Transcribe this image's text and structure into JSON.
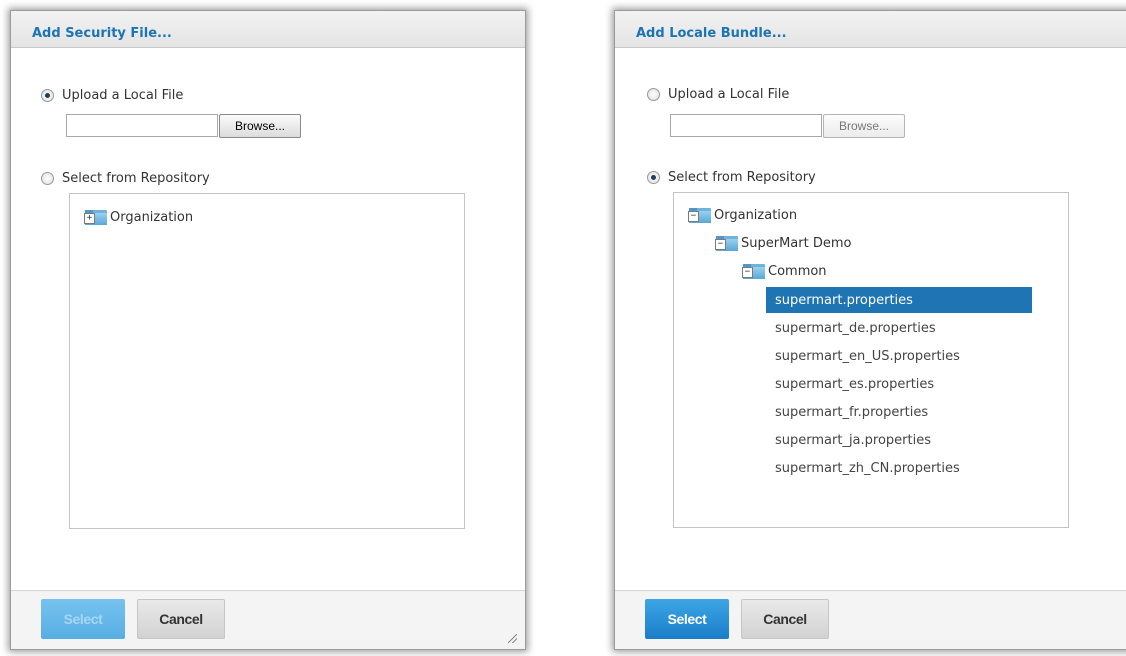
{
  "security_dialog": {
    "title": "Add Security File...",
    "upload_option": {
      "label": "Upload a Local File",
      "selected": true
    },
    "file_input_value": "",
    "browse_label": "Browse...",
    "repo_option": {
      "label": "Select from Repository",
      "selected": false
    },
    "tree": [
      {
        "label": "Organization",
        "toggle": "+",
        "expanded": false
      }
    ],
    "select_button": "Select",
    "select_enabled": false,
    "cancel_button": "Cancel"
  },
  "locale_dialog": {
    "title": "Add Locale Bundle...",
    "upload_option": {
      "label": "Upload a Local File",
      "selected": false
    },
    "file_input_value": "",
    "browse_label": "Browse...",
    "repo_option": {
      "label": "Select from Repository",
      "selected": true
    },
    "tree": [
      {
        "label": "Organization",
        "toggle": "−",
        "expanded": true
      },
      {
        "label": "SuperMart Demo",
        "toggle": "−",
        "expanded": true
      },
      {
        "label": "Common",
        "toggle": "−",
        "expanded": true
      }
    ],
    "files": [
      {
        "label": "supermart.properties",
        "selected": true
      },
      {
        "label": "supermart_de.properties",
        "selected": false
      },
      {
        "label": "supermart_en_US.properties",
        "selected": false
      },
      {
        "label": "supermart_es.properties",
        "selected": false
      },
      {
        "label": "supermart_fr.properties",
        "selected": false
      },
      {
        "label": "supermart_ja.properties",
        "selected": false
      },
      {
        "label": "supermart_zh_CN.properties",
        "selected": false
      }
    ],
    "select_button": "Select",
    "select_enabled": true,
    "cancel_button": "Cancel"
  },
  "colors": {
    "title_blue": "#1c75b3",
    "selection_blue": "#1f74b3",
    "primary_button": "#2b93d8"
  }
}
